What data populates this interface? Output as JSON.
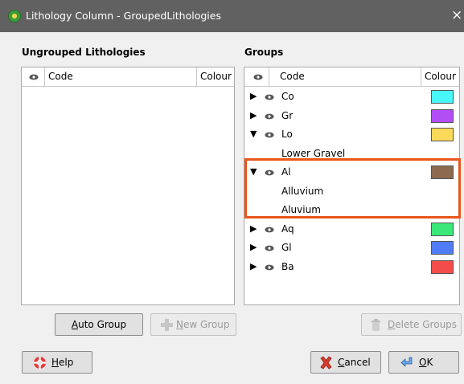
{
  "window": {
    "title": "Lithology Column - GroupedLithologies",
    "close_label": "×"
  },
  "ungrouped": {
    "title": "Ungrouped Lithologies",
    "columns": {
      "code": "Code",
      "colour": "Colour"
    },
    "rows": []
  },
  "groups": {
    "title": "Groups",
    "columns": {
      "code": "Code",
      "colour": "Colour"
    },
    "rows": [
      {
        "code": "Co",
        "expanded": false,
        "colour": "#48f7f7",
        "children": []
      },
      {
        "code": "Gr",
        "expanded": false,
        "colour": "#b24ef5",
        "children": []
      },
      {
        "code": "Lo",
        "expanded": true,
        "colour": "#fcd95a",
        "children": [
          "Lower Gravel"
        ]
      },
      {
        "code": "Al",
        "expanded": true,
        "colour": "#8b6a4f",
        "children": [
          "Alluvium",
          "Aluvium"
        ]
      },
      {
        "code": "Aq",
        "expanded": false,
        "colour": "#3ae87a",
        "children": []
      },
      {
        "code": "Gl",
        "expanded": false,
        "colour": "#4f7cf5",
        "children": []
      },
      {
        "code": "Ba",
        "expanded": false,
        "colour": "#f44b4b",
        "children": []
      }
    ]
  },
  "buttons": {
    "auto_group": {
      "mnemonic": "A",
      "rest": "uto Group"
    },
    "new_group": {
      "mnemonic": "N",
      "rest": "ew Group"
    },
    "delete_groups": {
      "mnemonic": "D",
      "rest": "elete Groups"
    },
    "help": {
      "mnemonic": "H",
      "rest": "elp"
    },
    "cancel": {
      "mnemonic": "C",
      "rest": "ancel"
    },
    "ok": {
      "mnemonic": "O",
      "rest": "K"
    }
  },
  "colors": {
    "highlight": "#e8561b",
    "titlebar": "#616161"
  }
}
